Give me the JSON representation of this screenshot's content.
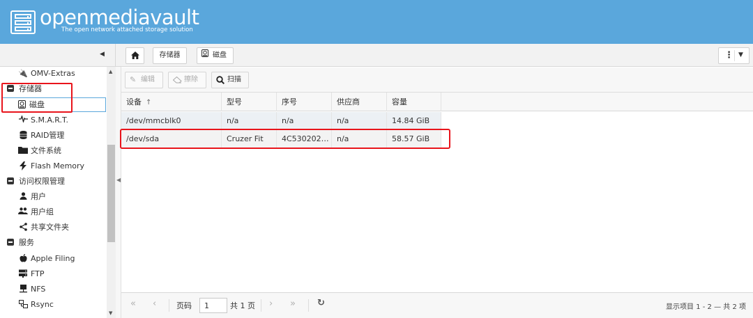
{
  "header": {
    "brand": "openmediavault",
    "tagline": "The open network attached storage solution"
  },
  "breadcrumb": {
    "home_icon": "home-icon",
    "items": [
      "存储器",
      "磁盘"
    ]
  },
  "sidebar": {
    "collapse_icon": "triangle-left-icon",
    "items": [
      {
        "label": "OMV-Extras",
        "icon": "plug-icon",
        "level": "sub"
      },
      {
        "label": "存储器",
        "icon": "minus-square-icon",
        "level": "group"
      },
      {
        "label": "磁盘",
        "icon": "disk-icon",
        "level": "sub",
        "selected": true
      },
      {
        "label": "S.M.A.R.T.",
        "icon": "pulse-icon",
        "level": "sub"
      },
      {
        "label": "RAID管理",
        "icon": "database-icon",
        "level": "sub"
      },
      {
        "label": "文件系统",
        "icon": "folder-icon",
        "level": "sub"
      },
      {
        "label": "Flash Memory",
        "icon": "bolt-icon",
        "level": "sub"
      },
      {
        "label": "访问权限管理",
        "icon": "minus-square-icon",
        "level": "group"
      },
      {
        "label": "用户",
        "icon": "user-icon",
        "level": "sub"
      },
      {
        "label": "用户组",
        "icon": "users-icon",
        "level": "sub"
      },
      {
        "label": "共享文件夹",
        "icon": "share-icon",
        "level": "sub"
      },
      {
        "label": "服务",
        "icon": "minus-square-icon",
        "level": "group"
      },
      {
        "label": "Apple Filing",
        "icon": "apple-icon",
        "level": "sub"
      },
      {
        "label": "FTP",
        "icon": "server-icon",
        "level": "sub"
      },
      {
        "label": "NFS",
        "icon": "network-icon",
        "level": "sub"
      },
      {
        "label": "Rsync",
        "icon": "sync-icon",
        "level": "sub"
      }
    ]
  },
  "toolbar": {
    "edit_label": "编辑",
    "wipe_label": "擦除",
    "scan_label": "扫描"
  },
  "grid": {
    "columns": [
      "设备",
      "型号",
      "序号",
      "供应商",
      "容量"
    ],
    "sort_indicator": "↑",
    "rows": [
      [
        "/dev/mmcblk0",
        "n/a",
        "n/a",
        "n/a",
        "14.84 GiB"
      ],
      [
        "/dev/sda",
        "Cruzer Fit",
        "4C5302020...",
        "n/a",
        "58.57 GiB"
      ]
    ]
  },
  "pager": {
    "page_label": "页码",
    "page_value": "1",
    "total_label": "共 1 页",
    "status": "显示项目 1 - 2 — 共 2 项"
  },
  "colors": {
    "header_bg": "#5aa7dc",
    "annotation_red": "#e8141b",
    "selection_border": "#5aa7dc"
  }
}
